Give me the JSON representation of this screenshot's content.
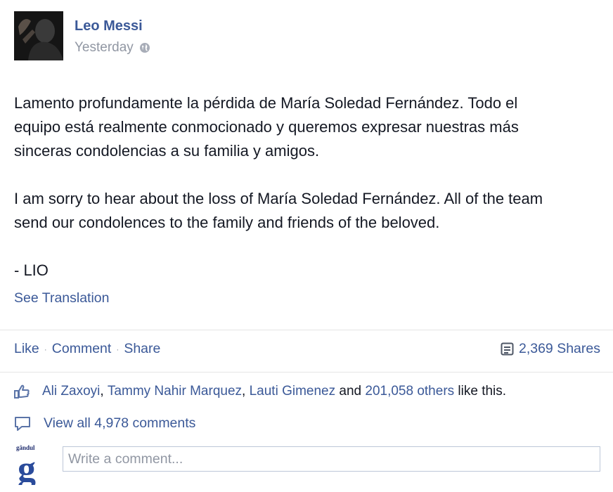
{
  "post": {
    "author": "Leo Messi",
    "timestamp": "Yesterday",
    "privacy_icon": "globe-icon",
    "paragraphs": [
      [
        "Lamento profundamente la pérdida de María Soledad Fernández. Todo el",
        "equipo está realmente conmocionado y queremos expresar nuestras más",
        "sinceras condolencias a su familia y amigos."
      ],
      [
        "I am sorry to hear about the loss of María Soledad Fernández. All of the team",
        "send our condolences to the family and friends of the beloved."
      ],
      [
        "- LIO"
      ]
    ],
    "see_translation": "See Translation"
  },
  "actions": {
    "like": "Like",
    "comment": "Comment",
    "share": "Share",
    "separator": "·",
    "shares_count": "2,369 Shares"
  },
  "likes": {
    "names": [
      "Ali Zaxoyi",
      "Tammy Nahir Marquez",
      "Lauti Gimenez"
    ],
    "comma": ", ",
    "and_text": " and ",
    "others": "201,058 others",
    "suffix": " like this."
  },
  "comments": {
    "view_all": "View all 4,978 comments"
  },
  "composer": {
    "logo_text": "gândul",
    "placeholder": "Write a comment..."
  },
  "colors": {
    "link": "#3b5998",
    "text": "#141823",
    "muted": "#9197a3",
    "divider": "#e5e5e5"
  }
}
